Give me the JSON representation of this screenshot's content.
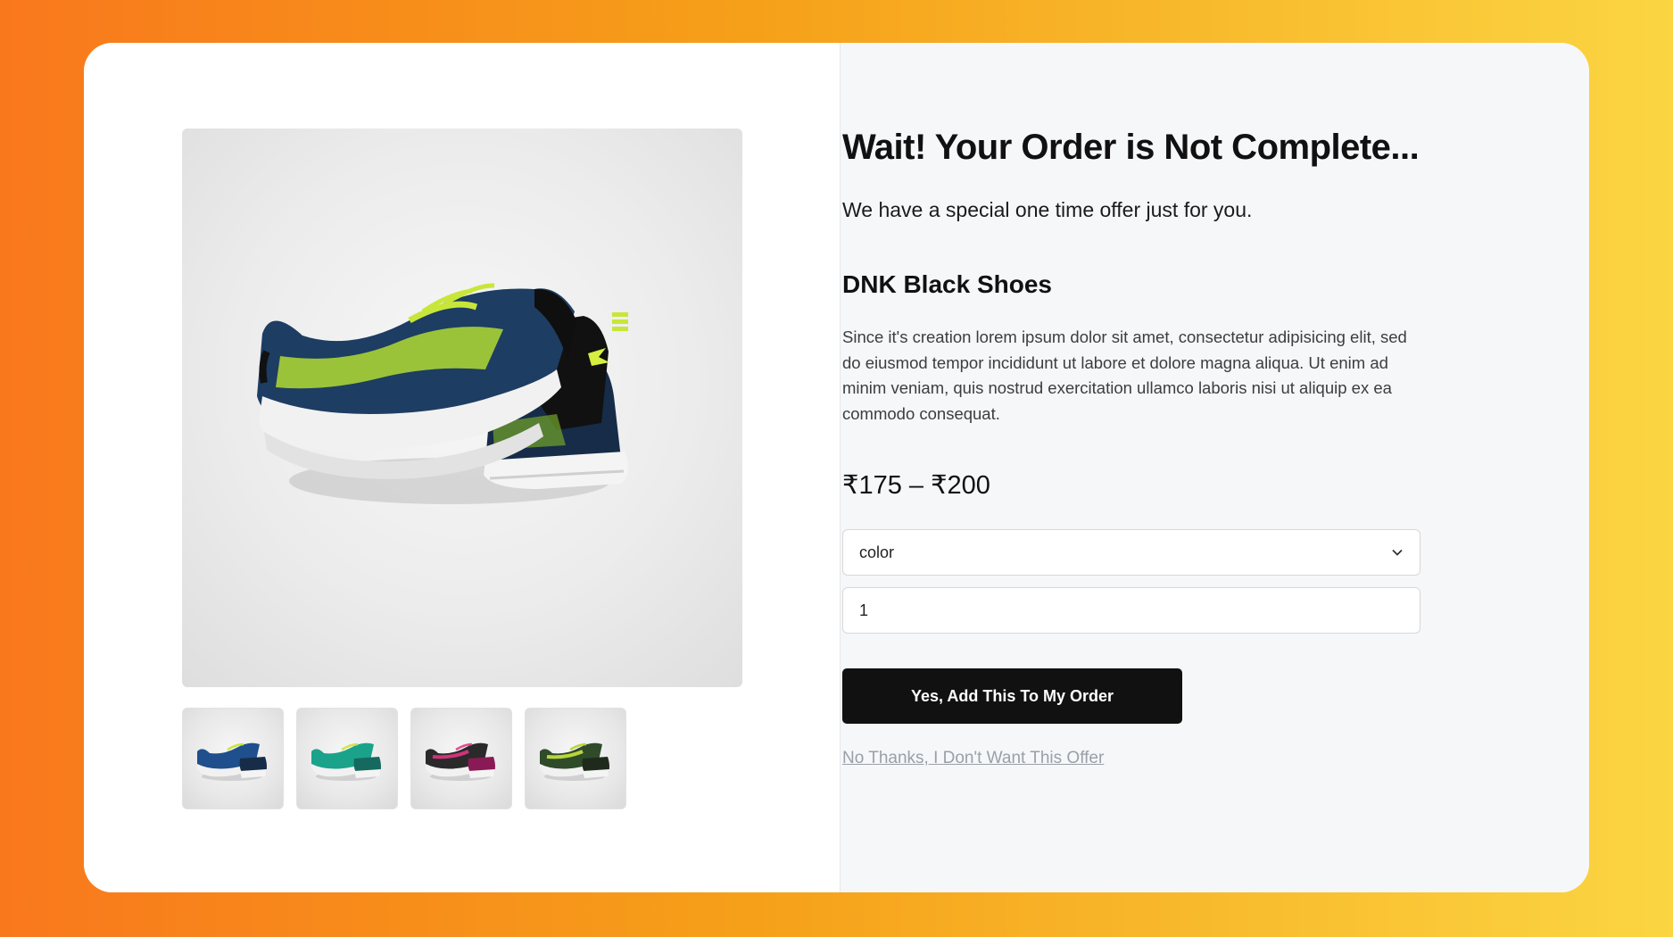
{
  "offer": {
    "headline": "Wait! Your Order is Not Complete...",
    "subline": "We have a special one time offer just for you."
  },
  "product": {
    "name": "DNK Black Shoes",
    "description": "Since it's creation lorem ipsum dolor sit amet, consectetur adipisicing elit, sed do eiusmod tempor incididunt ut labore et dolore magna aliqua. Ut enim ad minim veniam, quis nostrud exercitation ullamco laboris nisi ut aliquip ex ea commodo consequat.",
    "price": "₹175 – ₹200",
    "main_image_icon": "shoe-image",
    "thumbnails": [
      {
        "icon": "shoe-thumbnail",
        "accent": "#1f4f8c",
        "lace": "#c8e63a"
      },
      {
        "icon": "shoe-thumbnail",
        "accent": "#1aa38a",
        "lace": "#d6e34a"
      },
      {
        "icon": "shoe-thumbnail",
        "accent": "#8a1a55",
        "lace": "#e04f8f"
      },
      {
        "icon": "shoe-thumbnail",
        "accent": "#2f4b2a",
        "lace": "#b9d63a"
      }
    ]
  },
  "form": {
    "color_select_value": "color",
    "quantity_value": "1"
  },
  "actions": {
    "accept_label": "Yes, Add This To My Order",
    "decline_label": "No Thanks, I Don't Want This Offer"
  },
  "colors": {
    "background_gradient_start": "#f9781c",
    "background_gradient_end": "#fbd542",
    "cta_background": "#111111",
    "shoe_body": "#1e3f66",
    "shoe_accent": "#b7e03a"
  }
}
